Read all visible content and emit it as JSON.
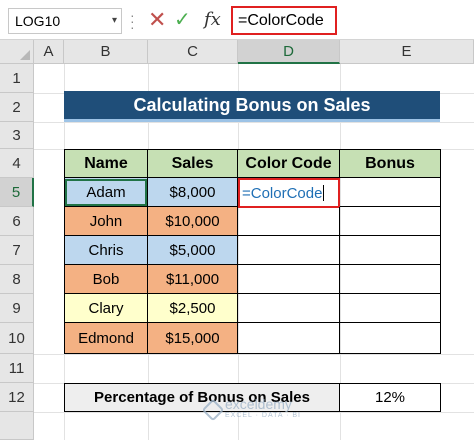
{
  "formula_bar": {
    "name_box": "LOG10",
    "cancel_glyph": "✕",
    "enter_glyph": "✓",
    "fx_label": "fx",
    "formula": "=ColorCode"
  },
  "columns": [
    "A",
    "B",
    "C",
    "D",
    "E"
  ],
  "rows": [
    "1",
    "2",
    "3",
    "4",
    "5",
    "6",
    "7",
    "8",
    "9",
    "10",
    "11",
    "12"
  ],
  "sheet": {
    "title": "Calculating Bonus on Sales",
    "headers": {
      "name": "Name",
      "sales": "Sales",
      "color_code": "Color Code",
      "bonus": "Bonus"
    },
    "records": [
      {
        "name": "Adam",
        "sales": "$8,000",
        "color_code": "=ColorCode",
        "bonus": "",
        "fill": "blue"
      },
      {
        "name": "John",
        "sales": "$10,000",
        "color_code": "",
        "bonus": "",
        "fill": "orange"
      },
      {
        "name": "Chris",
        "sales": "$5,000",
        "color_code": "",
        "bonus": "",
        "fill": "blue"
      },
      {
        "name": "Bob",
        "sales": "$11,000",
        "color_code": "",
        "bonus": "",
        "fill": "orange"
      },
      {
        "name": "Clary",
        "sales": "$2,500",
        "color_code": "",
        "bonus": "",
        "fill": "yellow"
      },
      {
        "name": "Edmond",
        "sales": "$15,000",
        "color_code": "",
        "bonus": "",
        "fill": "orange"
      }
    ],
    "percentage_label": "Percentage of Bonus on Sales",
    "percentage_value": "12%"
  },
  "colors": {
    "title_bg": "#1f4e79",
    "header_bg": "#c6e0b4",
    "blue_fill": "#bdd7ee",
    "orange_fill": "#f4b183",
    "yellow_fill": "#ffffcc",
    "highlight_border": "#e02020"
  },
  "watermark": {
    "brand": "exceldemy",
    "tagline": "EXCEL · DATA · BI"
  }
}
